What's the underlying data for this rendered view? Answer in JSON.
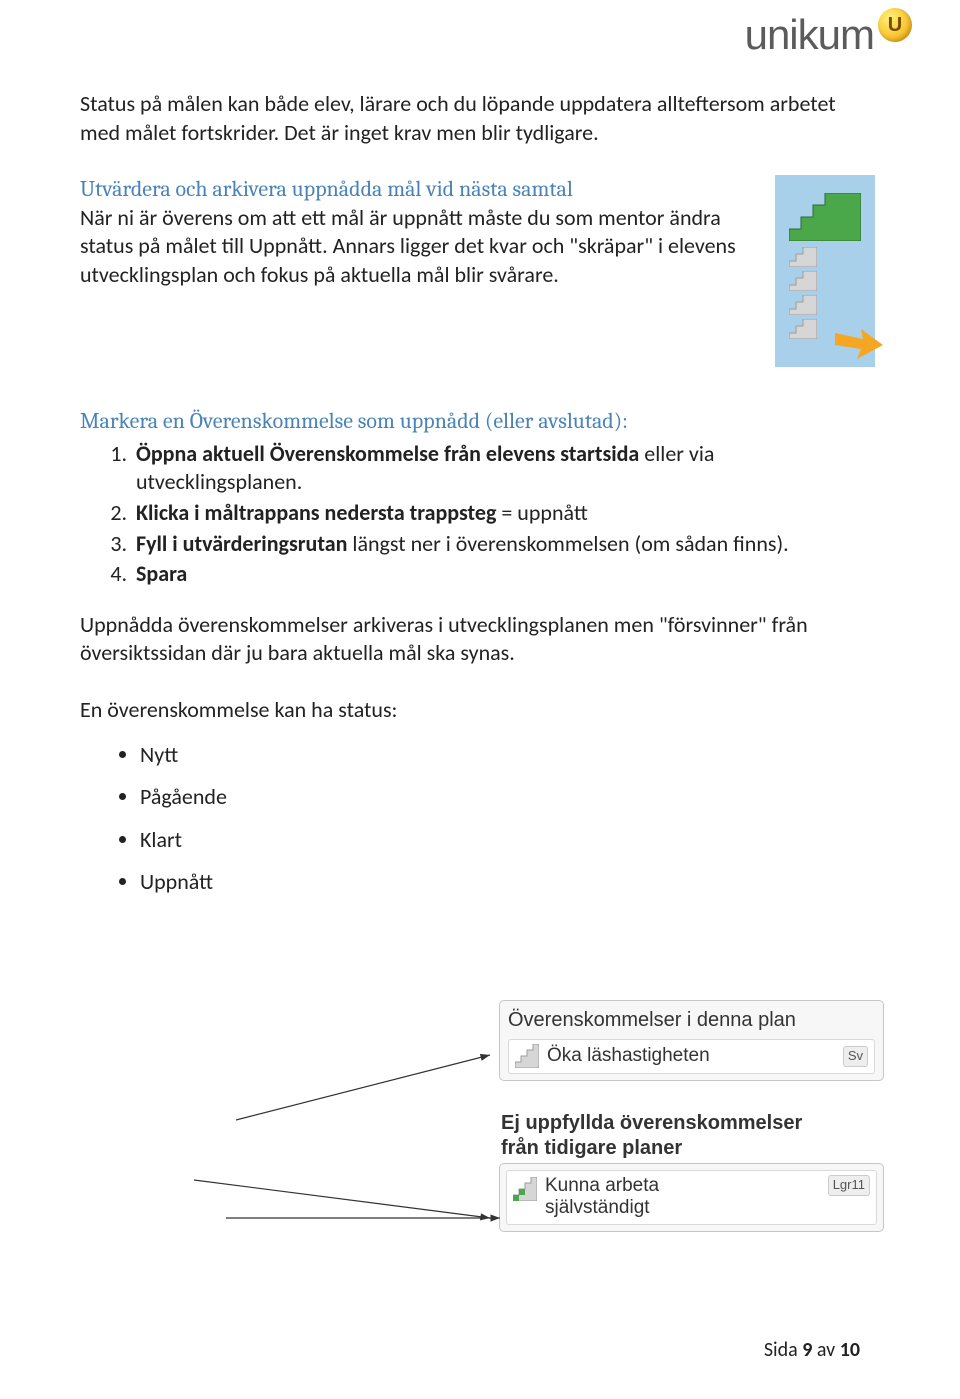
{
  "logo": {
    "text": "unikum",
    "badge_letter": "U"
  },
  "para1": "Status på målen kan både elev, lärare och du löpande uppdatera allteftersom arbetet med målet fortskrider. Det är inget krav men blir tydligare.",
  "section2": {
    "heading": "Utvärdera och arkivera uppnådda mål vid nästa samtal",
    "body": "När ni är överens om att ett mål är uppnått måste du som mentor ändra status på målet till Uppnått. Annars ligger det kvar och \"skräpar\" i elevens utvecklingsplan och fokus på aktuella mål blir svårare."
  },
  "section3": {
    "heading": "Markera en Överenskommelse som uppnådd (eller avslutad):",
    "steps": [
      {
        "bold": "Öppna aktuell Överenskommelse från elevens startsida",
        "rest": " eller via utvecklingsplanen."
      },
      {
        "bold": "Klicka i måltrappans nedersta trappsteg",
        "rest": " = uppnått"
      },
      {
        "bold": "Fyll i utvärderingsrutan",
        "rest": " längst ner i överenskommelsen (om sådan finns)."
      },
      {
        "bold": "Spara",
        "rest": ""
      }
    ]
  },
  "para_after": "Uppnådda överenskommelser arkiveras i utvecklingsplanen men \"försvinner\" från översiktssidan där ju bara aktuella mål ska synas.",
  "status_intro": "En överenskommelse kan ha status:",
  "status_list": [
    "Nytt",
    "Pågående",
    "Klart",
    "Uppnått"
  ],
  "widget1": {
    "title": "Överenskommelser i denna plan",
    "item_label": "Öka läshastigheten",
    "badge": "Sv"
  },
  "widget2": {
    "title_line1": "Ej uppfyllda överenskommelser",
    "title_line2": "från tidigare planer",
    "item_line1": "Kunna arbeta",
    "item_line2": "självständigt",
    "badge": "Lgr11"
  },
  "footer": {
    "prefix": "Sida ",
    "page": "9",
    "mid": " av ",
    "total": "10"
  }
}
